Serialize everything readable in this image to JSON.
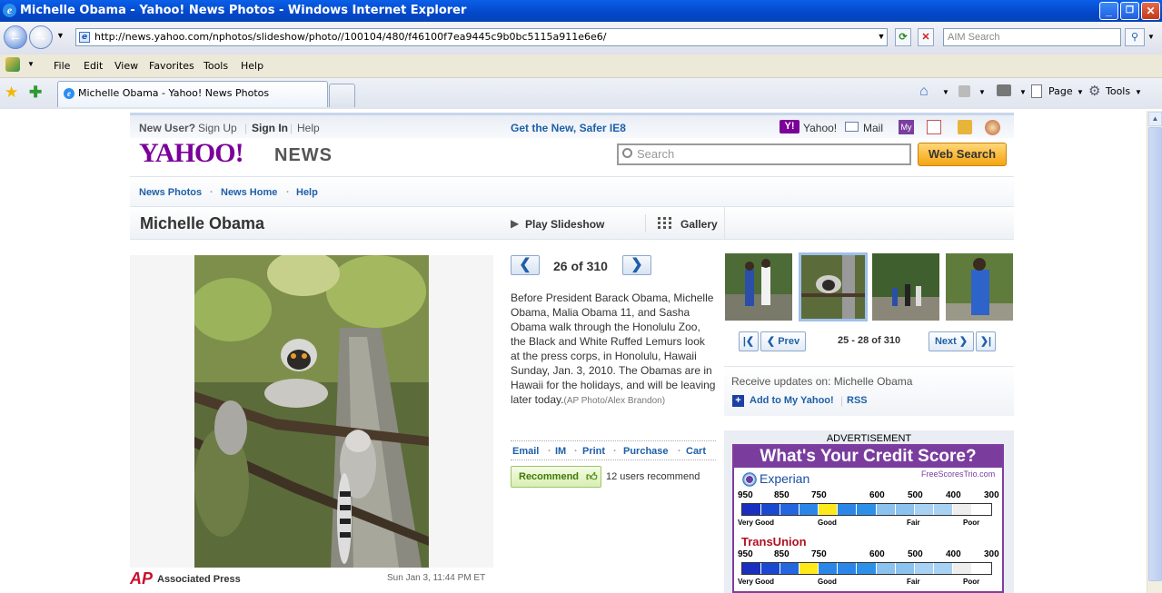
{
  "window": {
    "title": "Michelle Obama - Yahoo! News Photos - Windows Internet Explorer",
    "minimize": "_",
    "maximize": "❐",
    "close": "✕"
  },
  "browser": {
    "address": "http://news.yahoo.com/nphotos/slideshow/photo//100104/480/f46100f7ea9445c9b0bc5115a911e6e6/",
    "search_placeholder": "AIM Search",
    "menu": [
      "File",
      "Edit",
      "View",
      "Favorites",
      "Tools",
      "Help"
    ],
    "tab_title": "Michelle Obama - Yahoo! News Photos",
    "toolbar": {
      "page": "Page",
      "tools": "Tools"
    }
  },
  "yahoo_top": {
    "new_user": "New User?",
    "sign_up": "Sign Up",
    "sign_in": "Sign In",
    "help": "Help",
    "promo": "Get the New, Safer IE8",
    "yahoo": "Yahoo!",
    "mail": "Mail"
  },
  "header": {
    "logo": "YAHOO!",
    "news": "NEWS",
    "search_placeholder": "Search",
    "web_search": "Web Search"
  },
  "subnav": [
    "News Photos",
    "News Home",
    "Help"
  ],
  "slideshow": {
    "title": "Michelle Obama",
    "play": "Play Slideshow",
    "gallery": "Gallery",
    "counter": "26 of 310",
    "caption": "Before President Barack Obama, Michelle Obama, Malia Obama 11, and Sasha Obama walk through the Honolulu Zoo, the Black and White Ruffed Lemurs look at the press corps, in Honolulu, Hawaii Sunday, Jan. 3, 2010. The Obamas are in Hawaii for the holidays, and will be leaving later today.",
    "credit": "(AP Photo/Alex Brandon)",
    "source": "Associated Press",
    "date": "Sun Jan 3, 11:44 PM ET",
    "actions": [
      "Email",
      "IM",
      "Print",
      "Purchase",
      "Cart"
    ],
    "recommend": "Recommend",
    "recommend_count": "12 users recommend"
  },
  "thumbnails": {
    "prev": "Prev",
    "next": "Next",
    "range": "25 - 28 of 310"
  },
  "updates": {
    "label": "Receive updates on: Michelle Obama",
    "add": "Add to My Yahoo!",
    "rss": "RSS"
  },
  "ad": {
    "label": "ADVERTISEMENT",
    "headline": "What's Your Credit Score?",
    "site": "FreeScoresTrio.com",
    "bureau1": "Experian",
    "bureau2": "TransUnion",
    "scale": [
      "950",
      "850",
      "750",
      "600",
      "500",
      "400",
      "300"
    ],
    "ratings": [
      "Very Good",
      "Good",
      "Fair",
      "Poor"
    ]
  }
}
